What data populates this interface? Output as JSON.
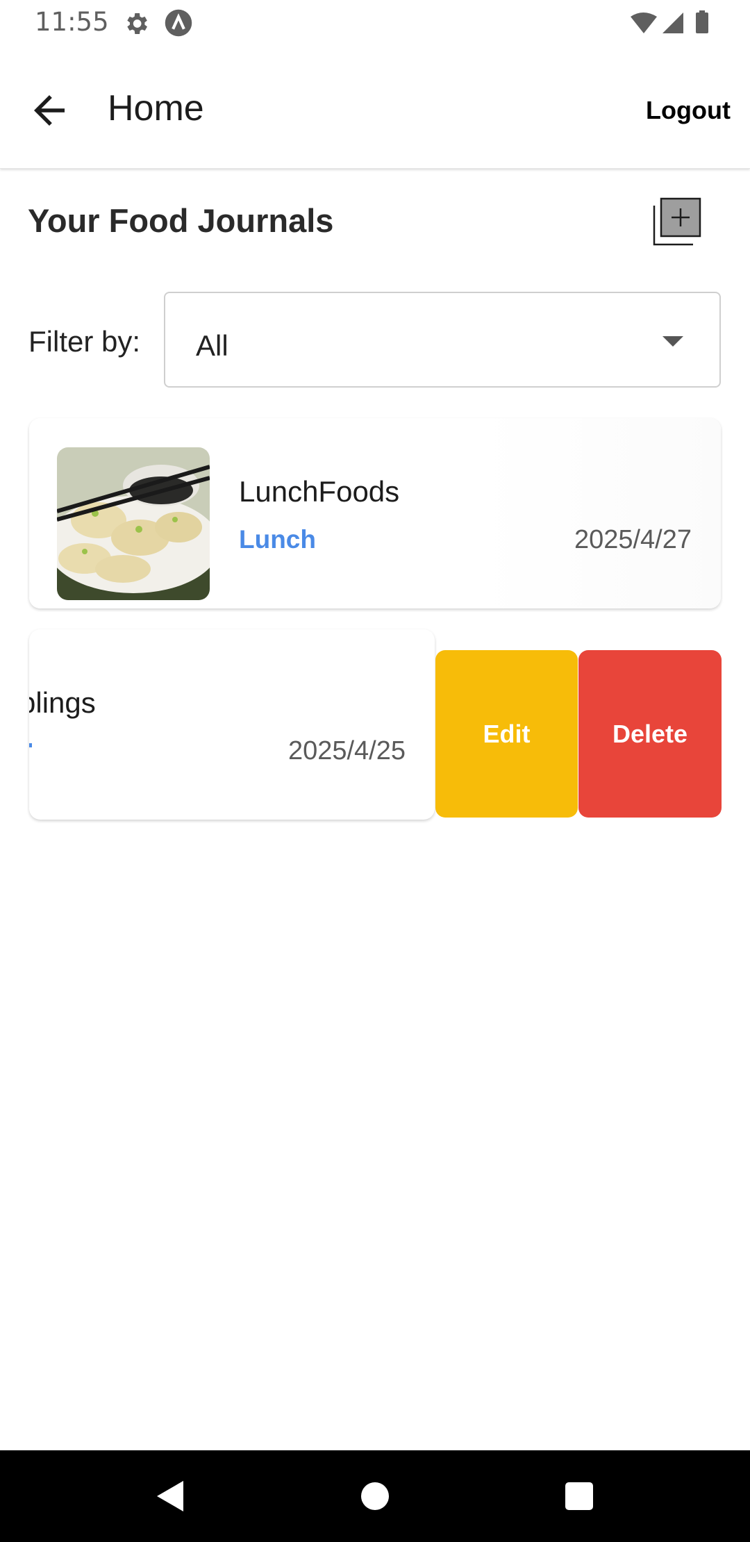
{
  "status_bar": {
    "time": "11:55"
  },
  "app_bar": {
    "title": "Home",
    "logout_label": "Logout"
  },
  "section": {
    "title": "Your Food Journals"
  },
  "filter": {
    "label": "Filter by:",
    "selected": "All"
  },
  "journals": [
    {
      "name": "LunchFoods",
      "meal": "Lunch",
      "date": "2025/4/27"
    },
    {
      "name_visible": "plings",
      "date": "2025/4/25"
    }
  ],
  "actions": {
    "edit_label": "Edit",
    "delete_label": "Delete"
  },
  "colors": {
    "meal_accent": "#4a8ae6",
    "edit": "#f7bc09",
    "delete": "#e8453a"
  }
}
